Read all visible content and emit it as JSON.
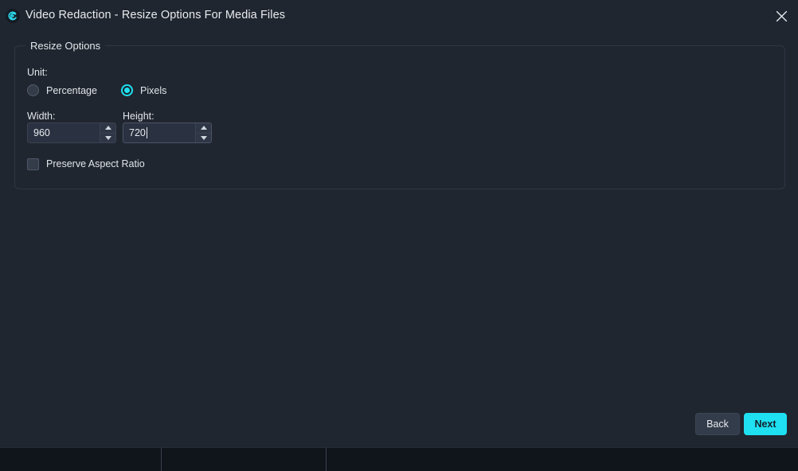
{
  "window": {
    "title": "Video Redaction - Resize Options For Media Files",
    "app_icon": "spiral-logo-icon",
    "close_icon": "close-icon",
    "accent_color": "#1fe0f0",
    "background_color": "#20262f"
  },
  "group": {
    "title": "Resize Options"
  },
  "unit": {
    "label": "Unit:",
    "selected": "Pixels",
    "options": [
      {
        "label": "Percentage",
        "selected": false
      },
      {
        "label": "Pixels",
        "selected": true
      }
    ]
  },
  "fields": {
    "width": {
      "label": "Width:",
      "value": "960",
      "focused": false
    },
    "height": {
      "label": "Height:",
      "value": "720",
      "focused": true
    },
    "spinner_up_icon": "chevron-up-icon",
    "spinner_down_icon": "chevron-down-icon"
  },
  "preserve_aspect_ratio": {
    "label": "Preserve Aspect Ratio",
    "checked": false
  },
  "footer": {
    "back_label": "Back",
    "next_label": "Next"
  }
}
